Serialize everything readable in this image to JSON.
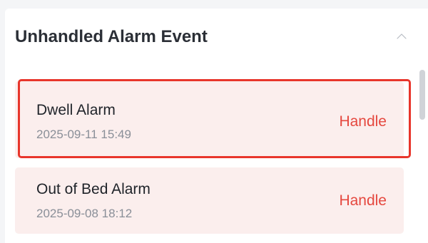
{
  "panel": {
    "title": "Unhandled Alarm Event",
    "collapse_icon": "chevron-up-icon"
  },
  "alarms": [
    {
      "name": "Dwell Alarm",
      "time": "2025-09-11 15:49",
      "action_label": "Handle",
      "highlighted": true
    },
    {
      "name": "Out of Bed Alarm",
      "time": "2025-09-08 18:12",
      "action_label": "Handle",
      "highlighted": false
    }
  ],
  "colors": {
    "item_background": "#fbeeed",
    "action_text": "#e5483f",
    "highlight_border": "#e8352b"
  }
}
